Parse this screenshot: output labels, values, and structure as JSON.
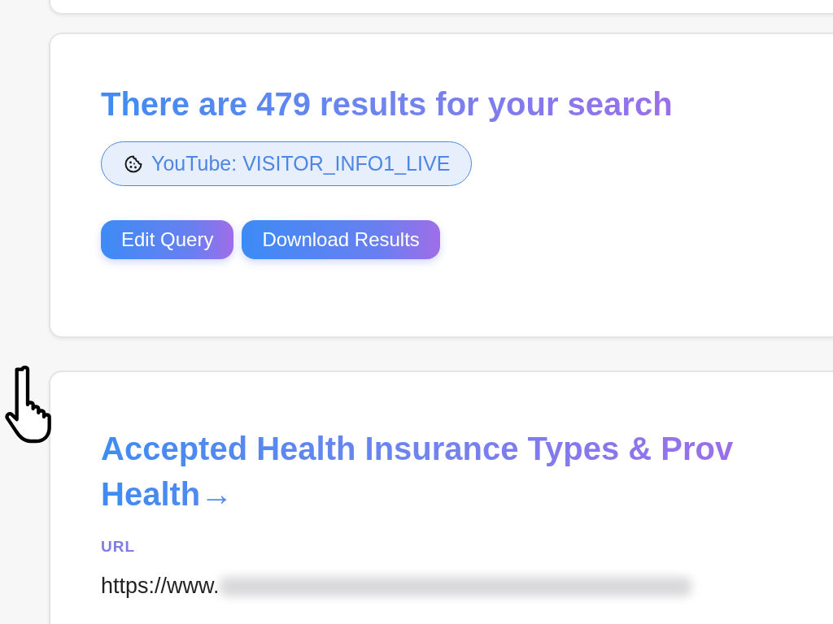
{
  "search_summary": {
    "title": "There are 479 results for your search",
    "cookie_tag": "YouTube: VISITOR_INFO1_LIVE",
    "buttons": [
      "Edit Query",
      "Download Results"
    ]
  },
  "result": {
    "title_lines": [
      "Accepted Health Insurance Types & Prov",
      "Health→"
    ],
    "url_label": "URL",
    "url_visible": "https://www."
  }
}
